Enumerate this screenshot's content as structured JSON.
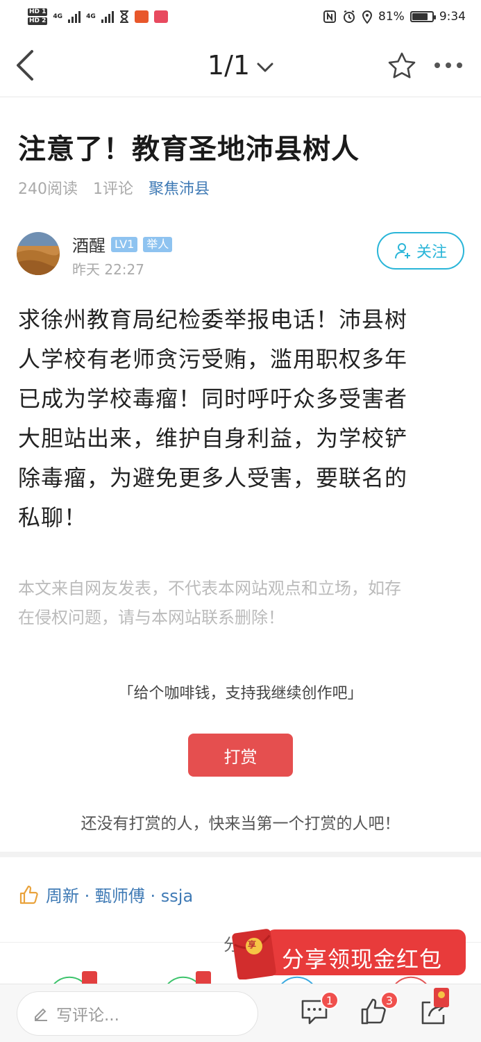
{
  "status_bar": {
    "hd_top": "HD 1",
    "hd_bottom": "HD 2",
    "net1": "4G",
    "net2": "4G",
    "battery_text": "81%",
    "battery_level": 0.81,
    "time": "9:34",
    "icons": [
      "signal-icon",
      "hourglass-icon",
      "app-icon",
      "reader-icon",
      "nfc-icon",
      "alarm-icon",
      "location-icon",
      "battery-icon"
    ]
  },
  "nav": {
    "page_indicator": "1/1",
    "icons": [
      "back-icon",
      "chevron-down-icon",
      "star-icon",
      "more-icon"
    ]
  },
  "article": {
    "title": "注意了！教育圣地沛县树人",
    "reads": "240阅读",
    "comments": "1评论",
    "topic": "聚焦沛县",
    "author": {
      "name": "酒醒",
      "level": "LV1",
      "rank": "举人",
      "time": "昨天 22:27",
      "follow_label": "关注"
    },
    "body_lines": [
      "求徐州教育局纪检委举报电话！沛县树",
      "人学校有老师贪污受贿，滥用职权多年",
      "已成为学校毒瘤！同时呼吁众多受害者",
      "大胆站出来，维护自身利益，为学校铲",
      "除毒瘤，为避免更多人受害，要联名的",
      "私聊！"
    ],
    "disclaimer_lines": [
      "本文来自网友发表，不代表本网站观点和立场，如存",
      "在侵权问题，请与本网站联系删除！"
    ]
  },
  "tip": {
    "quote": "「给个咖啡钱，支持我继续创作吧」",
    "button_label": "打赏",
    "empty_text": "还没有打赏的人，快来当第一个打赏的人吧！"
  },
  "likes": {
    "names": "周新 · 甄师傅 · ssja"
  },
  "share": {
    "label": "分"
  },
  "promo": {
    "text": "分享领现金红包",
    "envelope_char": "享"
  },
  "bottom_bar": {
    "comment_placeholder": "写评论...",
    "comment_count": "1",
    "like_count": "3"
  },
  "colors": {
    "accent_blue": "#3f7ab5",
    "follow_cyan": "#29b5d8",
    "tip_red": "#e54f4f",
    "promo_red": "#e83b3b"
  }
}
